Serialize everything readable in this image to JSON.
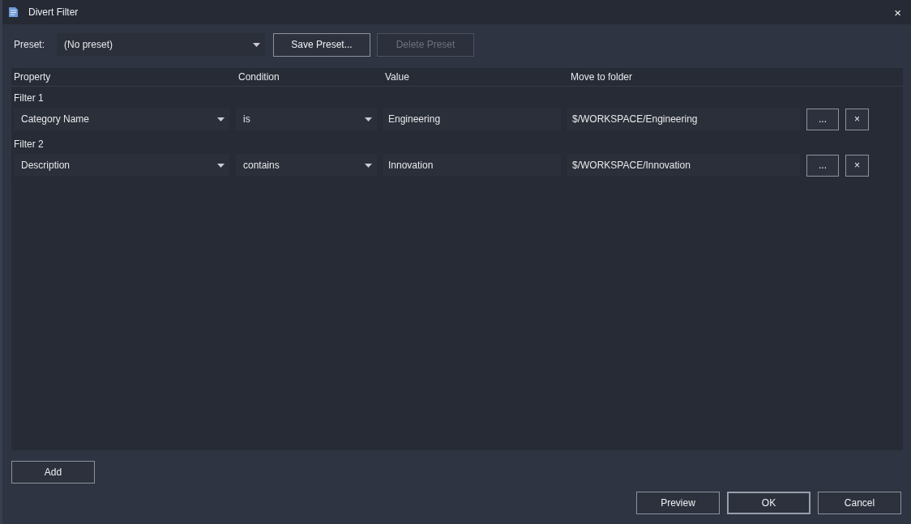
{
  "window": {
    "title": "Divert Filter",
    "close_label": "×"
  },
  "preset": {
    "label": "Preset:",
    "value": "(No preset)"
  },
  "preset_buttons": [
    {
      "label": "Save Preset...",
      "disabled": false
    },
    {
      "label": "Delete Preset",
      "disabled": true
    }
  ],
  "table": {
    "columns": [
      "Property",
      "Condition",
      "Value",
      "Move to folder"
    ],
    "filters": [
      {
        "label": "Filter 1",
        "property": "Category Name",
        "condition": "is",
        "value": "Engineering",
        "folder": "$/WORKSPACE/Engineering",
        "browse_label": "...",
        "remove_label": "×"
      },
      {
        "label": "Filter 2",
        "property": "Description",
        "condition": "contains",
        "value": "Innovation",
        "folder": "$/WORKSPACE/Innovation",
        "browse_label": "...",
        "remove_label": "×"
      }
    ]
  },
  "add_button": "Add",
  "footer_buttons": [
    {
      "label": "Preview",
      "default": false
    },
    {
      "label": "OK",
      "default": true
    },
    {
      "label": "Cancel",
      "default": false
    }
  ]
}
